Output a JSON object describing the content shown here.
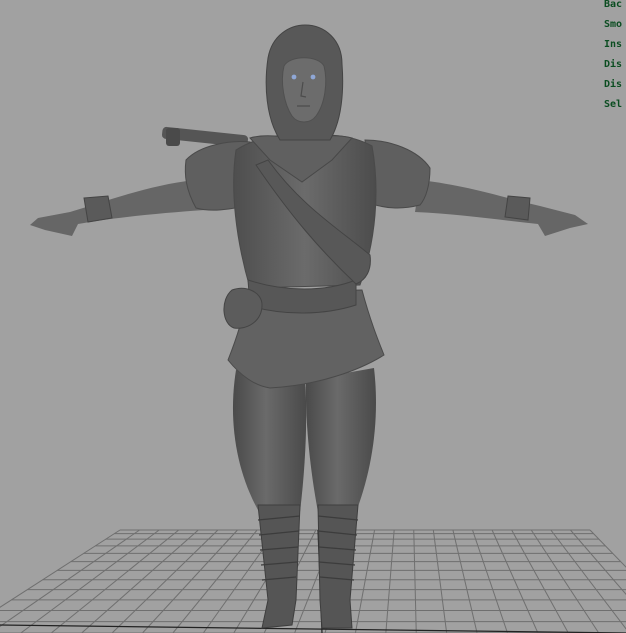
{
  "viewport": {
    "background_color": "#a1a1a1",
    "grid_color": "#6f6f6f",
    "model_color": "#5e5e5e"
  },
  "hud": {
    "lines": [
      "Bac",
      "Smo",
      "Ins",
      "Dis",
      "Dis",
      "Sel"
    ],
    "text_color": "#0b4d21"
  },
  "scene": {
    "objects": [
      "ground-grid",
      "character-model"
    ]
  }
}
